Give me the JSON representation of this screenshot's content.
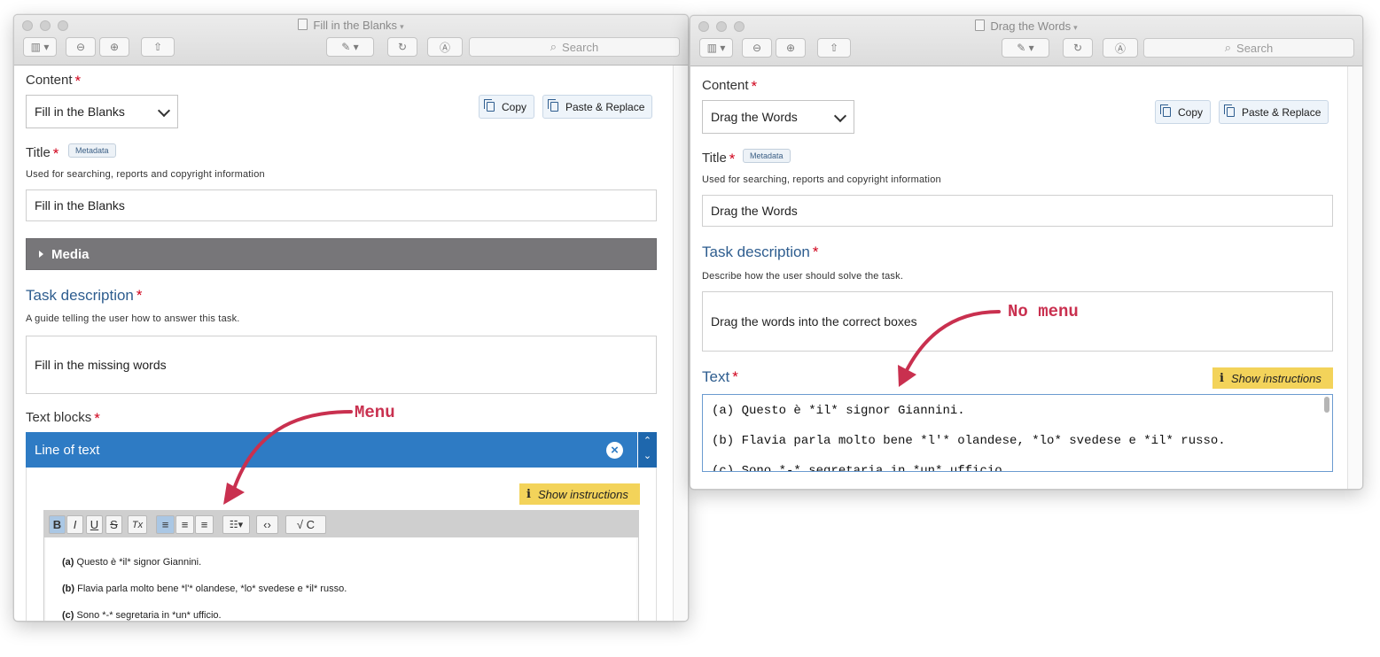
{
  "annotations": {
    "left": "Menu",
    "right": "No menu"
  },
  "toolbar": {
    "search_placeholder": "Search"
  },
  "window_left": {
    "title": "Fill in the Blanks",
    "content_label": "Content",
    "content_value": "Fill in the Blanks",
    "copy_label": "Copy",
    "paste_label": "Paste & Replace",
    "title_label": "Title",
    "metadata_badge": "Metadata",
    "title_desc": "Used for searching, reports and copyright information",
    "title_value": "Fill in the Blanks",
    "media_label": "Media",
    "task_label": "Task description",
    "task_desc": "A guide telling the user how to answer this task.",
    "task_value": "Fill in the missing words",
    "textblocks_label": "Text blocks",
    "line_label": "Line of text",
    "show_instructions": "Show instructions",
    "editor_buttons": [
      "B",
      "I",
      "U",
      "S",
      "Tx"
    ],
    "editor_lines": [
      {
        "prefix": "(a)",
        "text": " Questo è *il* signor Giannini."
      },
      {
        "prefix": "(b)",
        "text": " Flavia parla molto bene *l'* olandese, *lo* svedese e *il* russo."
      },
      {
        "prefix": "(c)",
        "text": " Sono *-* segretaria in *un* ufficio."
      }
    ]
  },
  "window_right": {
    "title": "Drag the Words",
    "content_label": "Content",
    "content_value": "Drag the Words",
    "copy_label": "Copy",
    "paste_label": "Paste & Replace",
    "title_label": "Title",
    "metadata_badge": "Metadata",
    "title_desc": "Used for searching, reports and copyright information",
    "title_value": "Drag the Words",
    "task_label": "Task description",
    "task_desc": "Describe how the user should solve the task.",
    "task_value": "Drag the words into the correct boxes",
    "text_label": "Text",
    "show_instructions": "Show instructions",
    "text_lines": [
      "(a) Questo è *il* signor Giannini.",
      "(b) Flavia parla molto bene *l'* olandese, *lo* svedese e *il* russo.",
      "(c) Sono *-* segretaria in *un* ufficio."
    ]
  }
}
